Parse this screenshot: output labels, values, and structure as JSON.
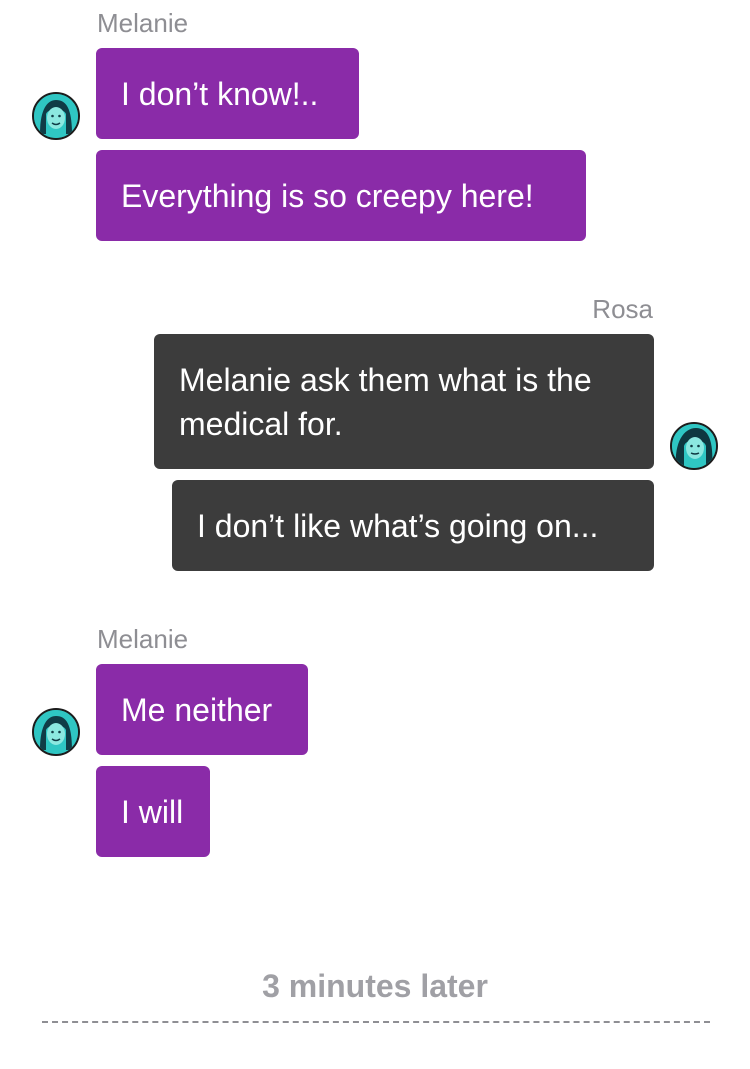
{
  "colors": {
    "incoming_bubble": "#8a2ba8",
    "outgoing_bubble": "#3c3c3c",
    "avatar_bg": "#2fc6c3",
    "meta_text": "#8e8e93"
  },
  "groups": [
    {
      "sender": "Melanie",
      "avatar_icon": "melanie-avatar-icon",
      "messages": [
        "I don’t know!..",
        "Everything is so creepy here!"
      ]
    },
    {
      "sender": "Rosa",
      "avatar_icon": "rosa-avatar-icon",
      "messages": [
        "Melanie ask them what is the medical for.",
        "I don’t like what’s going on..."
      ]
    },
    {
      "sender": "Melanie",
      "avatar_icon": "melanie-avatar-icon",
      "messages": [
        "Me neither",
        "I will"
      ]
    }
  ],
  "divider": {
    "label": "3 minutes later"
  }
}
